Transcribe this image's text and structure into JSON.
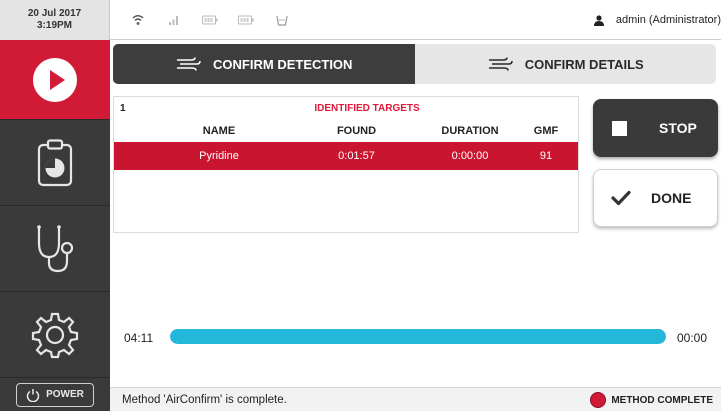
{
  "datetime": {
    "date": "20 Jul 2017",
    "time": "3:19PM"
  },
  "status_icons": [
    "wifi-icon",
    "signal-icon",
    "battery-icon",
    "battery-icon",
    "flask-icon"
  ],
  "user": {
    "label": "admin (Administrator)"
  },
  "nav": {
    "items": [
      "play-icon",
      "report-icon",
      "stethoscope-icon",
      "gear-icon"
    ],
    "power_label": "POWER",
    "accent_color": "#d11a35"
  },
  "tabs": [
    {
      "label": "CONFIRM DETECTION",
      "active": true
    },
    {
      "label": "CONFIRM DETAILS",
      "active": false
    }
  ],
  "results": {
    "count": "1",
    "title": "IDENTIFIED TARGETS",
    "columns": [
      "NAME",
      "FOUND",
      "DURATION",
      "GMF"
    ],
    "rows": [
      {
        "name": "Pyridine",
        "found": "0:01:57",
        "duration": "0:00:00",
        "gmf": "91"
      }
    ]
  },
  "buttons": {
    "stop_label": "STOP",
    "done_label": "DONE"
  },
  "progress": {
    "elapsed": "04:11",
    "remaining": "00:00",
    "fraction": 1.0,
    "color": "#23b7d9"
  },
  "statusbar": {
    "message": "Method 'AirConfirm' is complete.",
    "method_status": "METHOD COMPLETE",
    "status_color": "#d11a35"
  }
}
